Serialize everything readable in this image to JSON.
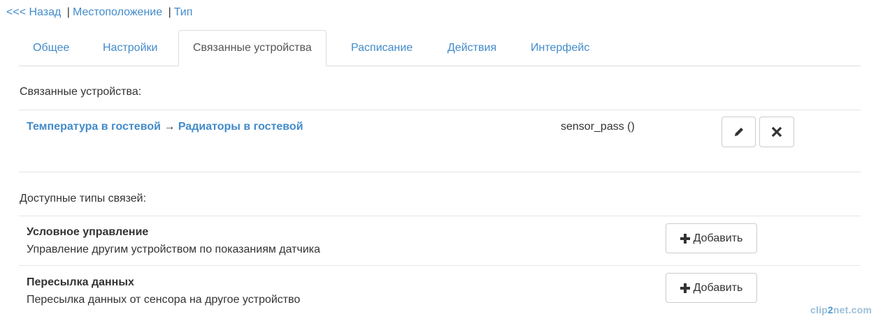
{
  "breadcrumb": {
    "back": "<<< Назад",
    "location": "Местоположение",
    "type": "Тип",
    "separator": "|"
  },
  "tabs": [
    {
      "label": "Общее",
      "active": false
    },
    {
      "label": "Настройки",
      "active": false
    },
    {
      "label": "Связанные устройства",
      "active": true
    },
    {
      "label": "Расписание",
      "active": false
    },
    {
      "label": "Действия",
      "active": false
    },
    {
      "label": "Интерфейс",
      "active": false
    }
  ],
  "linked": {
    "heading": "Связанные устройства:",
    "items": [
      {
        "source": "Температура в гостевой",
        "arrow": "→",
        "target": "Радиаторы в гостевой",
        "type": "sensor_pass ()",
        "edit_icon": "pencil-icon",
        "delete_icon": "remove-icon"
      }
    ]
  },
  "available": {
    "heading": "Доступные типы связей:",
    "add_label": "Добавить",
    "add_icon": "plus-icon",
    "items": [
      {
        "title": "Условное управление",
        "description": "Управление другим устройством по показаниям датчика"
      },
      {
        "title": "Пересылка данных",
        "description": "Пересылка данных от сенсора на другое устройство"
      }
    ]
  },
  "watermark": {
    "pre": "clip",
    "hi": "2",
    "post": "net.com"
  },
  "colors": {
    "link": "#428bca",
    "text": "#333333",
    "border": "#dddddd"
  }
}
